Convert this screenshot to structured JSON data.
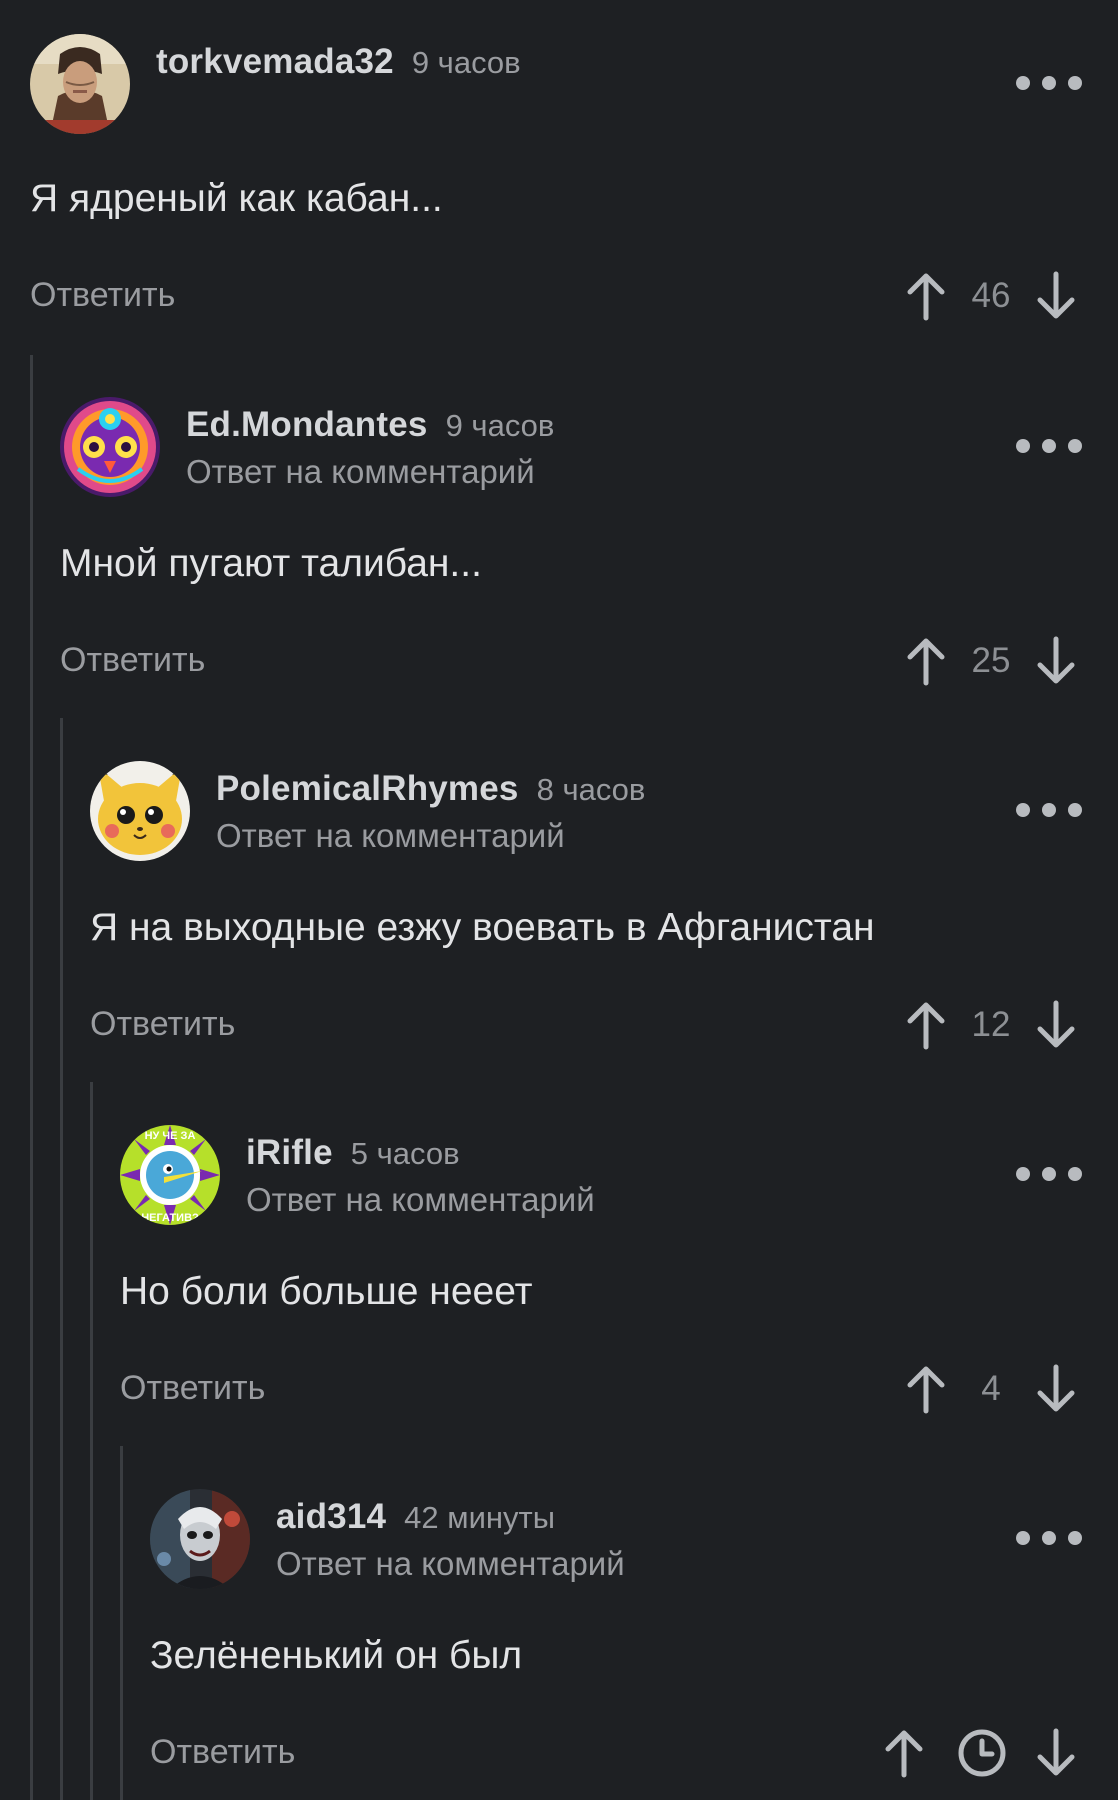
{
  "comments": [
    {
      "username": "torkvemada32",
      "time": "9 часов",
      "reply_to": "",
      "text": "Я ядреный как кабан...",
      "reply_label": "Ответить",
      "score": "46",
      "avatar_icon": "monk-portrait"
    },
    {
      "username": "Ed.Mondantes",
      "time": "9 часов",
      "reply_to": "Ответ на комментарий",
      "text": "Мной пугают талибан...",
      "reply_label": "Ответить",
      "score": "25",
      "avatar_icon": "psychedelic-owl"
    },
    {
      "username": "PolemicalRhymes",
      "time": "8 часов",
      "reply_to": "Ответ на комментарий",
      "text": "Я на выходные езжу воевать в Афганистан",
      "reply_label": "Ответить",
      "score": "12",
      "avatar_icon": "plush-pikachu"
    },
    {
      "username": "iRifle",
      "time": "5 часов",
      "reply_to": "Ответ на комментарий",
      "text": "Но боли больше нееет",
      "reply_label": "Ответить",
      "score": "4",
      "avatar_icon": "bird-sticker",
      "avatar_text_top": "НУ ЧЕ ЗА",
      "avatar_text_bottom": "НЕГАТИВ?"
    },
    {
      "username": "aid314",
      "time": "42 минуты",
      "reply_to": "Ответ на комментарий",
      "text": "Зелёненький он был",
      "reply_label": "Ответить",
      "score": "",
      "score_pending_icon": "clock-icon",
      "avatar_icon": "dark-collage"
    }
  ],
  "colors": {
    "background": "#1e2023",
    "thread_line": "#3a3d41",
    "muted_text": "#9a9ca0",
    "body_text": "#e3e4e6"
  }
}
